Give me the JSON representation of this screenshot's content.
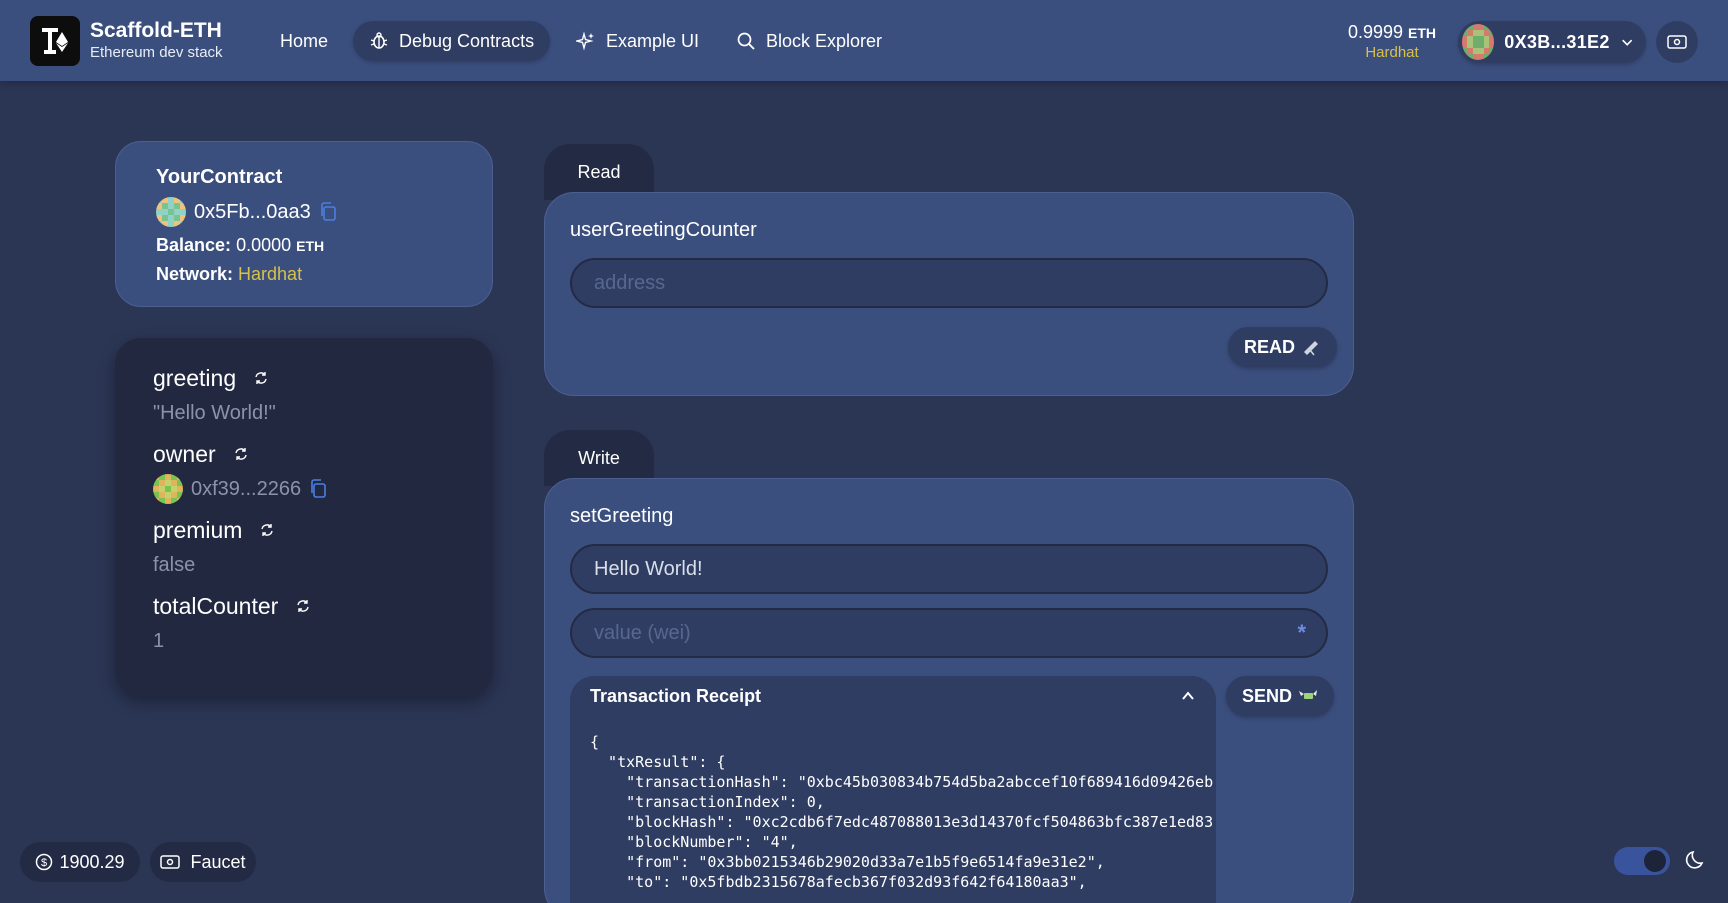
{
  "brand": {
    "title": "Scaffold-ETH",
    "subtitle": "Ethereum dev stack"
  },
  "nav": [
    {
      "label": "Home",
      "icon": "none",
      "active": false
    },
    {
      "label": "Debug Contracts",
      "icon": "bug-icon",
      "active": true
    },
    {
      "label": "Example UI",
      "icon": "sparkles-icon",
      "active": false
    },
    {
      "label": "Block Explorer",
      "icon": "search-icon",
      "active": false
    }
  ],
  "wallet": {
    "balance": "0.9999",
    "unit": "ETH",
    "network": "Hardhat",
    "account": "0X3B...31E2"
  },
  "contract": {
    "name": "YourContract",
    "address": "0x5Fb...0aa3",
    "balance_label": "Balance:",
    "balance_value": "0.0000",
    "balance_unit": "ETH",
    "network_label": "Network:",
    "network_value": "Hardhat"
  },
  "variables": [
    {
      "name": "greeting",
      "value": "\"Hello World!\""
    },
    {
      "name": "owner",
      "value": "0xf39...2266"
    },
    {
      "name": "premium",
      "value": "false"
    },
    {
      "name": "totalCounter",
      "value": "1"
    }
  ],
  "read": {
    "tab": "Read",
    "function": "userGreetingCounter",
    "input_placeholder": "address",
    "button": "READ"
  },
  "write": {
    "tab": "Write",
    "function": "setGreeting",
    "input_value": "Hello World!",
    "value_placeholder": "value (wei)",
    "value_star": "*",
    "button": "SEND"
  },
  "receipt": {
    "title": "Transaction Receipt",
    "lines": [
      "{",
      "  \"txResult\": {",
      "    \"transactionHash\": \"0xbc45b030834b754d5ba2abccef10f689416d09426eb",
      "    \"transactionIndex\": 0,",
      "    \"blockHash\": \"0xc2cdb6f7edc487088013e3d14370fcf504863bfc387e1ed83",
      "    \"blockNumber\": \"4\",",
      "    \"from\": \"0x3bb0215346b29020d33a7e1b5f9e6514fa9e31e2\",",
      "    \"to\": \"0x5fbdb2315678afecb367f032d93f642f64180aa3\","
    ]
  },
  "footer": {
    "price": "1900.29",
    "faucet": "Faucet"
  },
  "colors": {
    "accent": "#d6c14b",
    "navbar": "#3b4f7f",
    "background": "#2b3655",
    "dark_card": "#222840"
  }
}
